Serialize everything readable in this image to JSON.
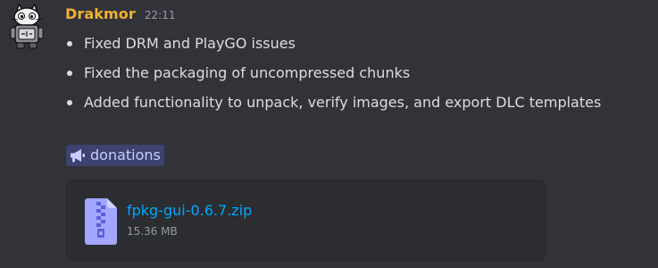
{
  "message": {
    "author": "Drakmor",
    "timestamp": "22:11",
    "changes": [
      "Fixed DRM and PlayGO issues",
      "Fixed the packaging of uncompressed chunks",
      "Added functionality to unpack, verify images, and export DLC templates"
    ],
    "channel_mention": "donations",
    "attachment": {
      "file_name": "fpkg-gui-0.6.7.zip",
      "file_size": "15.36 MB"
    }
  },
  "icons": {
    "avatar": "cat-robot-avatar",
    "channel": "megaphone-icon",
    "file": "zip-file-icon"
  },
  "colors": {
    "background": "#323339",
    "username": "#f0b232",
    "timestamp": "#949ba4",
    "text": "#dbdee1",
    "mention_bg": "#3d4270",
    "mention_text": "#c9cdfb",
    "link": "#00a8fc",
    "attachment_bg": "#2b2d31",
    "file_icon": "#a2a6ff"
  }
}
